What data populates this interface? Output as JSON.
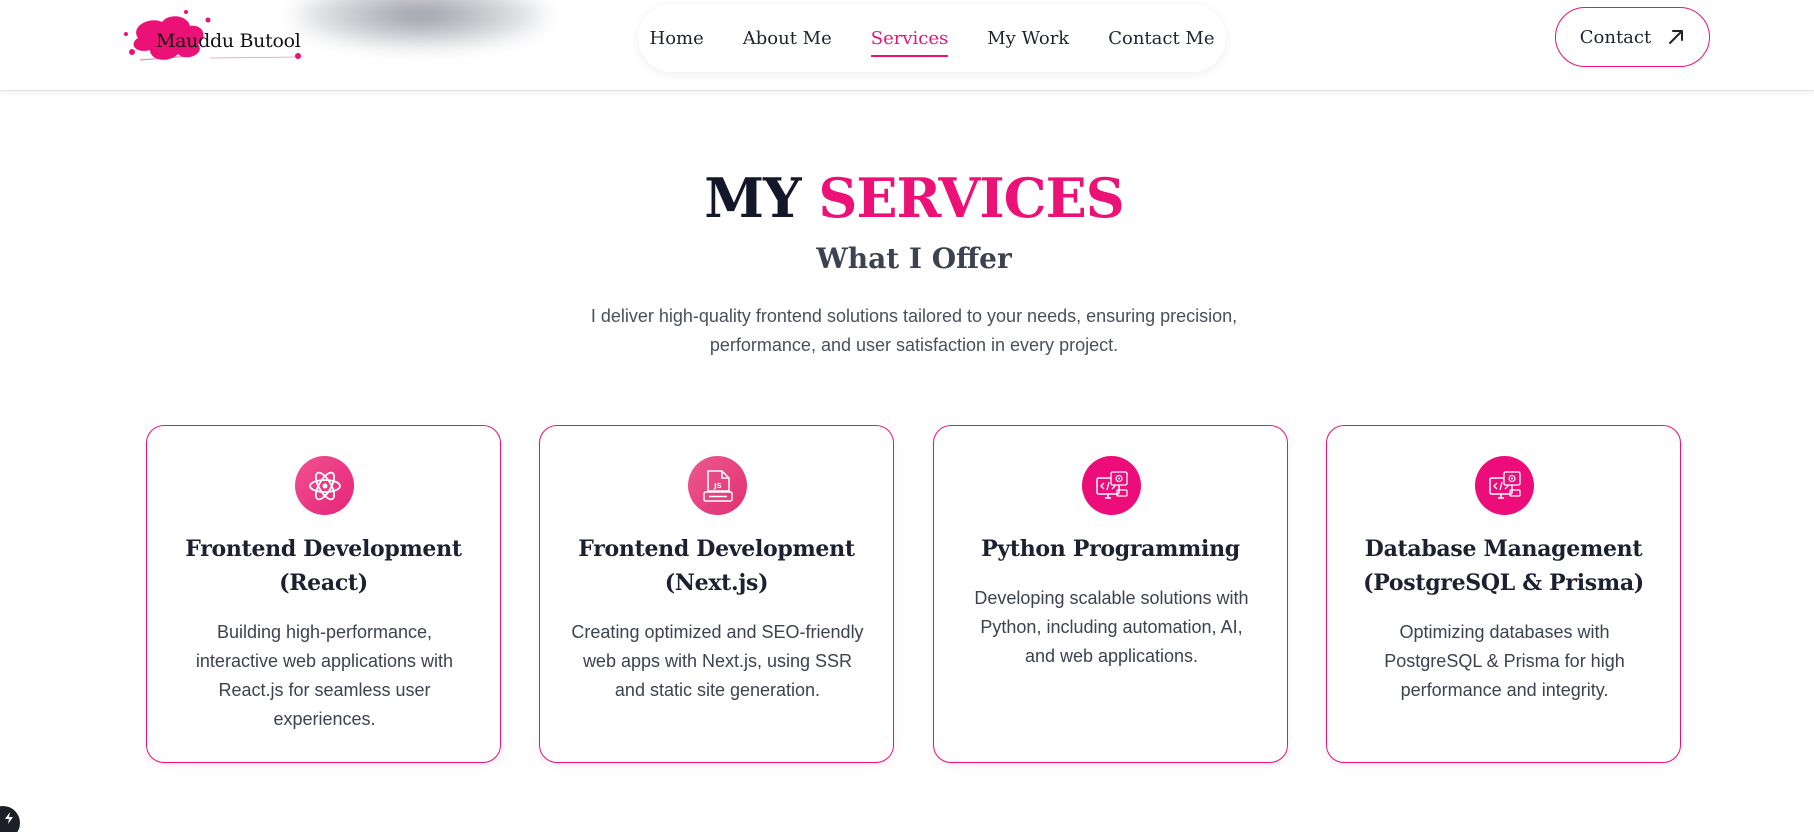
{
  "header": {
    "logo_text": "Mauddu Butool",
    "nav": [
      {
        "label": "Home",
        "active": false
      },
      {
        "label": "About Me",
        "active": false
      },
      {
        "label": "Services",
        "active": true
      },
      {
        "label": "My Work",
        "active": false
      },
      {
        "label": "Contact Me",
        "active": false
      }
    ],
    "contact_label": "Contact"
  },
  "section": {
    "title_part1": "MY",
    "title_part2": "SERVICES",
    "subtitle": "What I Offer",
    "intro": "I deliver high-quality frontend solutions tailored to your needs, ensuring precision, performance, and user satisfaction in every project."
  },
  "services": [
    {
      "title": "Frontend Development (React)",
      "description": "Building high-performance, interactive web applications with React.js for seamless user experiences.",
      "icon": "react-atom-icon"
    },
    {
      "title": "Frontend Development (Next.js)",
      "description": "Creating optimized and SEO-friendly web apps with Next.js, using SSR and static site generation.",
      "icon": "js-file-icon"
    },
    {
      "title": "Python Programming",
      "description": "Developing scalable solutions with Python, including automation, AI, and web applications.",
      "icon": "code-monitor-icon"
    },
    {
      "title": "Database Management (PostgreSQL & Prisma)",
      "description": "Optimizing databases with PostgreSQL & Prisma for high performance and integrity.",
      "icon": "code-monitor-icon"
    }
  ],
  "colors": {
    "accent": "#ec1177",
    "text_dark": "#14172a",
    "text_body": "#3d4250"
  }
}
